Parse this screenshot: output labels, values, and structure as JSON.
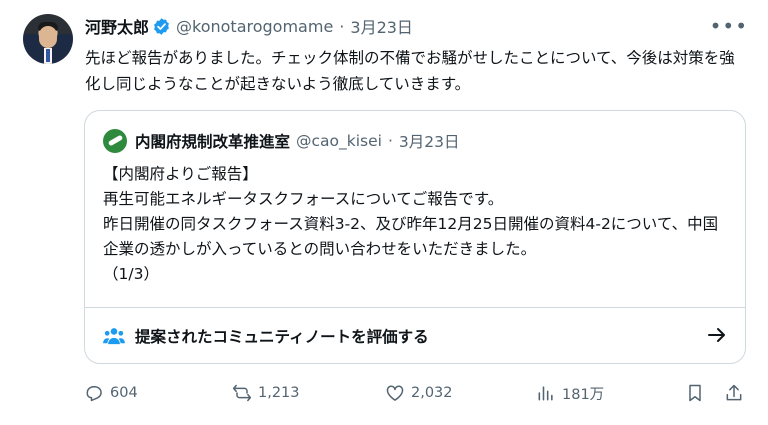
{
  "tweet": {
    "author_name": "河野太郎",
    "handle": "@konotarogomame",
    "separator": "·",
    "date": "3月23日",
    "more_label": "•••",
    "text": "先ほど報告がありました。チェック体制の不備でお騒がせしたことについて、今後は対策を強化し同じようなことが起きないよう徹底していきます。"
  },
  "quote": {
    "author_name": "内閣府規制改革推進室",
    "handle": "@cao_kisei",
    "separator": "·",
    "date": "3月23日",
    "lines": [
      "【内閣府よりご報告】",
      "再生可能エネルギータスクフォースについてご報告です。",
      "昨日開催の同タスクフォース資料3-2、及び昨年12月25日開催の資料4-2について、中国企業の透かしが入っているとの問い合わせをいただきました。",
      "（1/3）"
    ],
    "community_note_label": "提案されたコミュニティノートを評価する"
  },
  "actions": {
    "replies": "604",
    "reposts": "1,213",
    "likes": "2,032",
    "views": "181万"
  },
  "colors": {
    "text": "#0f1419",
    "muted": "#536471",
    "border": "#cfd9de",
    "verified": "#1d9bf0",
    "quote_avatar": "#2e8b3e"
  },
  "icons": [
    "verified-badge-icon",
    "more-icon",
    "community-icon",
    "arrow-right-icon",
    "reply-icon",
    "repost-icon",
    "like-icon",
    "views-icon",
    "bookmark-icon",
    "share-icon"
  ]
}
